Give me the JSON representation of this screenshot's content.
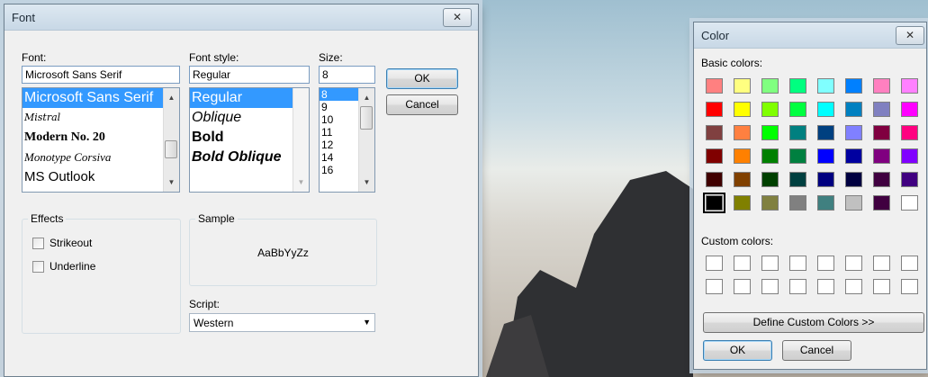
{
  "font_dialog": {
    "title": "Font",
    "close_glyph": "✕",
    "font_label": "Font:",
    "font_value": "Microsoft Sans Serif",
    "fonts": [
      "Microsoft Sans Serif",
      "Mistral",
      "Modern No. 20",
      "Monotype Corsiva",
      "MS Outlook"
    ],
    "style_label": "Font style:",
    "style_value": "Regular",
    "styles": [
      "Regular",
      "Oblique",
      "Bold",
      "Bold Oblique"
    ],
    "size_label": "Size:",
    "size_value": "8",
    "sizes": [
      "8",
      "9",
      "10",
      "11",
      "12",
      "14",
      "16"
    ],
    "ok_label": "OK",
    "cancel_label": "Cancel",
    "effects_label": "Effects",
    "strikeout_label": "Strikeout",
    "underline_label": "Underline",
    "sample_label": "Sample",
    "sample_text": "AaBbYyZz",
    "script_label": "Script:",
    "script_value": "Western"
  },
  "color_dialog": {
    "title": "Color",
    "close_glyph": "✕",
    "basic_label": "Basic colors:",
    "basic_colors": [
      [
        "#ff8080",
        "#ffff80",
        "#80ff80",
        "#00ff80",
        "#80ffff",
        "#0080ff",
        "#ff80c0",
        "#ff80ff"
      ],
      [
        "#ff0000",
        "#ffff00",
        "#80ff00",
        "#00ff40",
        "#00ffff",
        "#0080c0",
        "#8080c0",
        "#ff00ff"
      ],
      [
        "#804040",
        "#ff8040",
        "#00ff00",
        "#008080",
        "#004080",
        "#8080ff",
        "#800040",
        "#ff0080"
      ],
      [
        "#800000",
        "#ff8000",
        "#008000",
        "#008040",
        "#0000ff",
        "#0000a0",
        "#800080",
        "#8000ff"
      ],
      [
        "#400000",
        "#804000",
        "#004000",
        "#004040",
        "#000080",
        "#000040",
        "#400040",
        "#400080"
      ],
      [
        "#000000",
        "#808000",
        "#808040",
        "#808080",
        "#408080",
        "#c0c0c0",
        "#400040",
        "#ffffff"
      ]
    ],
    "custom_label": "Custom colors:",
    "define_label": "Define Custom Colors >>",
    "ok_label": "OK",
    "cancel_label": "Cancel"
  }
}
